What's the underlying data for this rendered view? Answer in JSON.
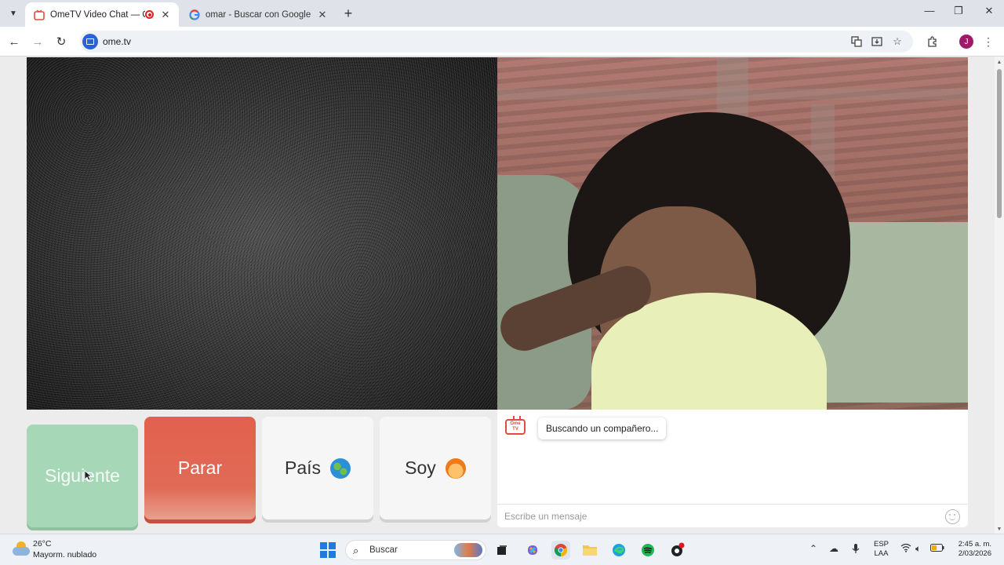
{
  "browser": {
    "tabs": [
      {
        "title": "OmeTV Video Chat — Ome",
        "active": true,
        "recording": true
      },
      {
        "title": "omar - Buscar con Google",
        "active": false
      }
    ],
    "address": "ome.tv"
  },
  "controls": {
    "next_label": "Siguiente",
    "stop_label": "Parar",
    "country_label": "País",
    "gender_label": "Soy"
  },
  "chat": {
    "logo_text": "Ome TV",
    "status_message": "Buscando un compañero...",
    "input_placeholder": "Escribe un mensaje"
  },
  "taskbar": {
    "weather_temp": "26°C",
    "weather_desc": "Mayorm. nublado",
    "search_label": "Buscar",
    "lang_line1": "ESP",
    "lang_line2": "LAA",
    "time": "2:45 a. m.",
    "date": "2/03/2026"
  },
  "colors": {
    "next_button": "#a6d7b6",
    "stop_button": "#e2604e",
    "accent": "#e24c3a"
  }
}
